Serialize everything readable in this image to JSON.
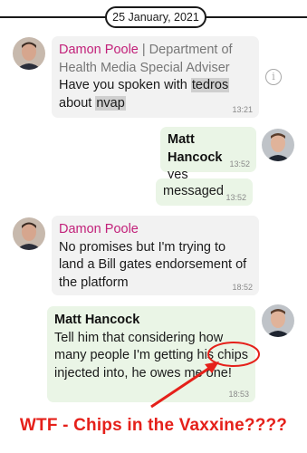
{
  "date": "25 January, 2021",
  "messages": [
    {
      "sender": "Damon Poole",
      "role": "| Department of Health Media Special Adviser",
      "text_before": "Have you spoken with",
      "hl1": "tedros",
      "text_mid": "about",
      "hl2": "nvap",
      "time": "13:21",
      "avatar": "damon-poole-avatar"
    },
    {
      "sender": "Matt Hancock",
      "text": "yes",
      "time": "13:52",
      "avatar": "matt-hancock-avatar"
    },
    {
      "text": "messaged",
      "time": "13:52"
    },
    {
      "sender": "Damon Poole",
      "text": "No promises but I'm trying to land a Bill gates endorsement of the platform",
      "time": "18:52",
      "avatar": "damon-poole-avatar"
    },
    {
      "sender": "Matt Hancock",
      "text": "Tell him that considering how many people I'm getting his chips injected into, he owes me one!",
      "time": "18:53",
      "avatar": "matt-hancock-avatar"
    }
  ],
  "info_icon": "info-icon",
  "caption": "WTF  -  Chips in the Vaxxine????",
  "colors": {
    "sender_pink": "#c2217a",
    "annotation_red": "#e5201a",
    "incoming_bg": "#f2f2f2",
    "outgoing_bg": "#eaf5e6"
  }
}
